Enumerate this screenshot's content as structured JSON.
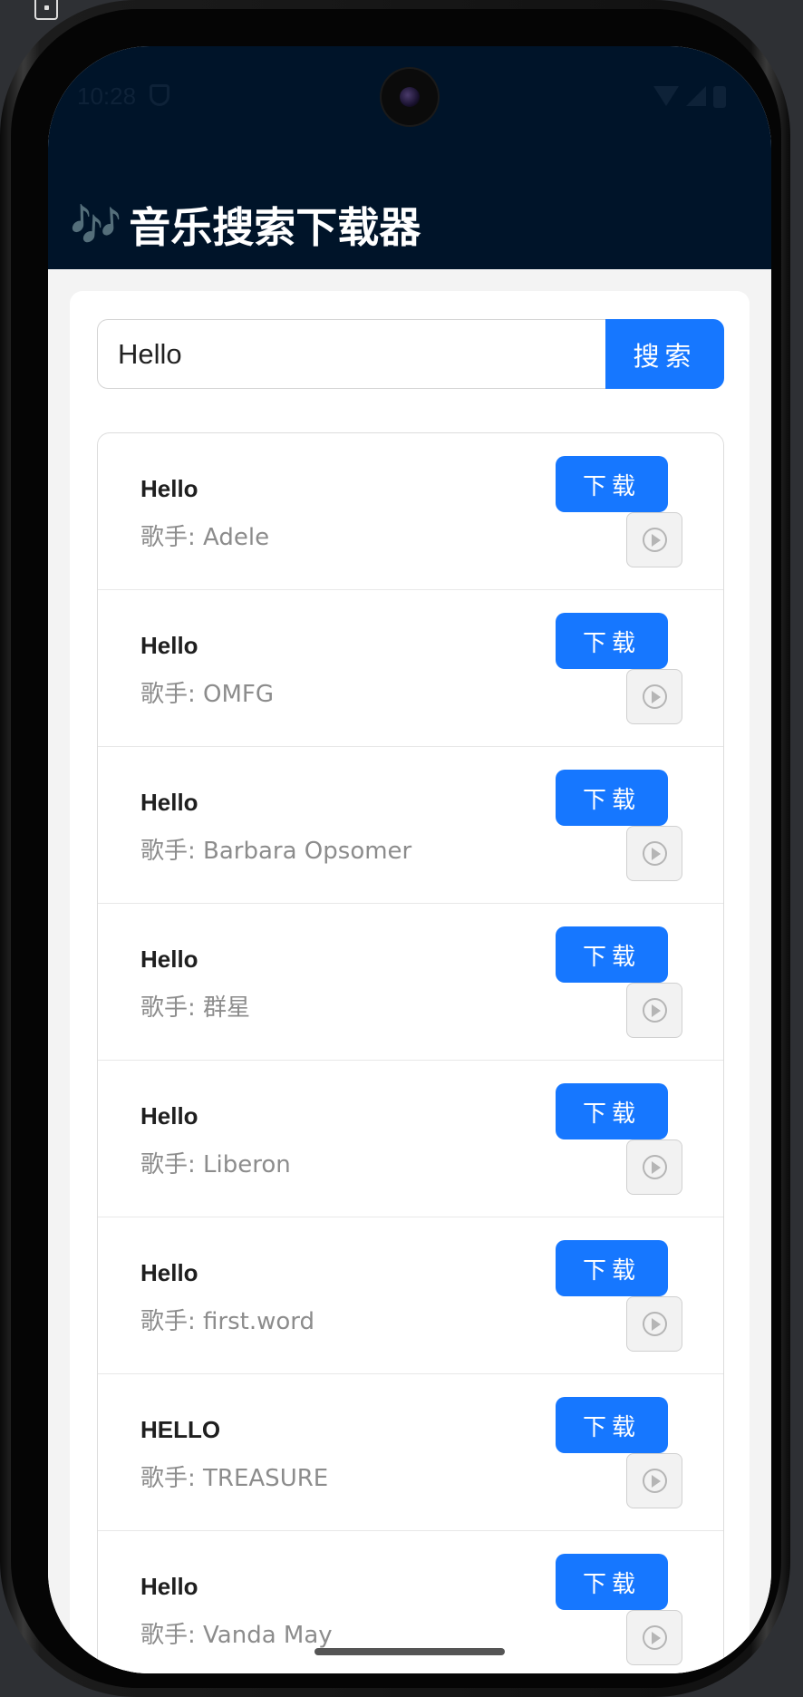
{
  "status_bar": {
    "time": "10:28"
  },
  "app": {
    "icon": "music-notes-icon",
    "title": "音乐搜索下载器",
    "title_prefix": "🎶"
  },
  "search": {
    "value": "Hello",
    "button_label": "搜索"
  },
  "results": [
    {
      "title": "Hello",
      "artist": "歌手: Adele",
      "download_label": "下载"
    },
    {
      "title": "Hello",
      "artist": "歌手: OMFG",
      "download_label": "下载"
    },
    {
      "title": "Hello",
      "artist": "歌手: Barbara Opsomer",
      "download_label": "下载"
    },
    {
      "title": "Hello",
      "artist": "歌手: 群星",
      "download_label": "下载"
    },
    {
      "title": "Hello",
      "artist": "歌手: Liberon",
      "download_label": "下载"
    },
    {
      "title": "Hello",
      "artist": "歌手: first.word",
      "download_label": "下载"
    },
    {
      "title": "HELLO",
      "artist": "歌手: TREASURE",
      "download_label": "下载"
    },
    {
      "title": "Hello",
      "artist": "歌手: Vanda May",
      "download_label": "下载"
    }
  ],
  "colors": {
    "header_bg": "#001429",
    "primary": "#1677ff",
    "page_bg": "#f3f3f3"
  }
}
